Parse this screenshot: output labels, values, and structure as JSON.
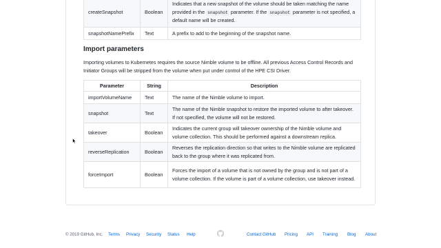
{
  "top_table": {
    "rows": [
      {
        "param": "createSnapshot",
        "type": "Boolean",
        "desc_1": "Indicates that a new snapshot of the volume should be taken matching the name provided in the ",
        "code_1": "snapshot",
        "desc_2": " parameter. If the ",
        "code_2": "snapshot",
        "desc_3": " parameter is not specified, a default name will be created."
      },
      {
        "param": "snapshotNamePrefix",
        "type": "Text",
        "desc": "A prefix to add to the beginning of the snapshot name."
      }
    ]
  },
  "import_section": {
    "heading": "Import parameters",
    "description": "Importing volumes to Kubernetes requires the source Nimble volume to be offline. All previous Access Control Records and Initiator Groups will be stripped from the volume when put under control of the HPE CSI Driver."
  },
  "import_table": {
    "headers": [
      "Parameter",
      "String",
      "Description"
    ],
    "rows": [
      {
        "param": "importVolumeName",
        "type": "Text",
        "desc": "The name of the Nimble volume to import."
      },
      {
        "param": "snapshot",
        "type": "Text",
        "desc": "The name of the Nimble snapshot to restore the imported volume to after takeover. If not specified, the volume will not be restored."
      },
      {
        "param": "takeover",
        "type": "Boolean",
        "desc": "Indicates the current group will takeover ownership of the Nimble volume and volume collection. This should be performed against a downstream replica."
      },
      {
        "param": "reverseReplication",
        "type": "Boolean",
        "desc": "Reverses the replication direction so that writes to the Nimble volume are replicated back to the group where it was replicated from."
      },
      {
        "param": "forceImport",
        "type": "Boolean",
        "desc": "Forces the import of a volume that is not owned by the group and is not part of a volume collection. If the volume is part of a volume collection, use takeover instead."
      }
    ]
  },
  "footer": {
    "copyright": "© 2019 GitHub, Inc.",
    "links_left": [
      "Terms",
      "Privacy",
      "Security",
      "Status",
      "Help"
    ],
    "links_right": [
      "Contact GitHub",
      "Pricing",
      "API",
      "Training",
      "Blog",
      "About"
    ],
    "logo_icon": "github-octocat-icon"
  },
  "colors": {
    "link": "#0366d6",
    "text": "#24292e",
    "muted": "#586069",
    "border": "#dfe2e5",
    "row_alt": "#f6f8fa"
  }
}
